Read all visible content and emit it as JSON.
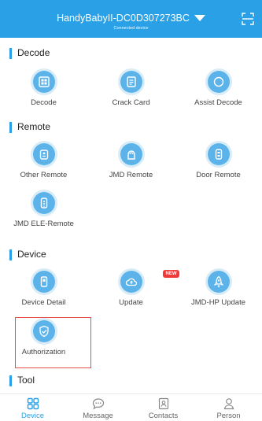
{
  "header": {
    "device_name": "HandyBabyII-DC0D307273BC",
    "status": "Connected device"
  },
  "sections": {
    "decode": {
      "title": "Decode",
      "items": [
        {
          "label": "Decode",
          "icon": "decode-grid-icon"
        },
        {
          "label": "Crack Card",
          "icon": "crack-card-icon"
        },
        {
          "label": "Assist Decode",
          "icon": "assist-decode-icon"
        }
      ]
    },
    "remote": {
      "title": "Remote",
      "items": [
        {
          "label": "Other Remote",
          "icon": "other-remote-icon"
        },
        {
          "label": "JMD Remote",
          "icon": "jmd-remote-icon"
        },
        {
          "label": "Door Remote",
          "icon": "door-remote-icon"
        },
        {
          "label": "JMD ELE-Remote",
          "icon": "jmd-ele-remote-icon"
        }
      ]
    },
    "device": {
      "title": "Device",
      "items": [
        {
          "label": "Device Detail",
          "icon": "device-detail-icon"
        },
        {
          "label": "Update",
          "icon": "cloud-upload-icon",
          "badge": "NEW"
        },
        {
          "label": "JMD-HP Update",
          "icon": "rocket-icon"
        },
        {
          "label": "Authorization",
          "icon": "shield-check-icon"
        }
      ]
    },
    "tool": {
      "title": "Tool"
    }
  },
  "tabbar": {
    "items": [
      {
        "label": "Device",
        "icon": "device-grid-icon",
        "active": true
      },
      {
        "label": "Message",
        "icon": "message-bubble-icon",
        "active": false
      },
      {
        "label": "Contacts",
        "icon": "contacts-card-icon",
        "active": false
      },
      {
        "label": "Person",
        "icon": "person-icon",
        "active": false
      }
    ]
  },
  "colors": {
    "accent": "#2aa0e6",
    "icon_fill": "#5bb3ea",
    "badge": "#ef3a3a",
    "highlight": "#e94b4b"
  }
}
